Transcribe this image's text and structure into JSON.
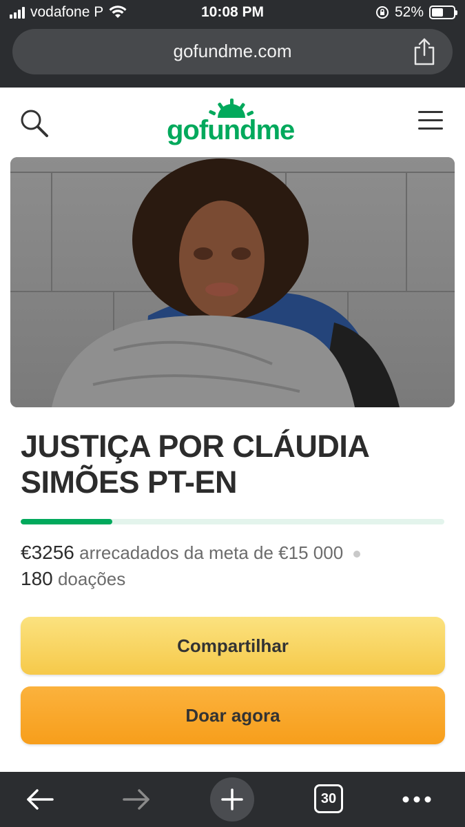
{
  "status_bar": {
    "carrier": "vodafone P",
    "time": "10:08 PM",
    "battery": "52%",
    "battery_level": 0.52
  },
  "browser": {
    "url": "gofundme.com"
  },
  "site": {
    "logo_text": "gofundme",
    "brand_color": "#02a95c"
  },
  "campaign": {
    "title": "JUSTIÇA POR CLÁUDIA SIMÕES PT-EN",
    "raised": "€3256",
    "raised_text": "arrecadados da meta de €15 000",
    "progress": 0.217,
    "donations_count": "180",
    "donations_label": "doações"
  },
  "actions": {
    "share_label": "Compartilhar",
    "donate_label": "Doar agora",
    "share_color": "#f6c94a",
    "donate_color": "#f79e1b"
  },
  "toolbar": {
    "tabs_count": "30"
  },
  "icons": [
    "signal-icon",
    "wifi-icon",
    "rotation-lock-icon",
    "battery-icon",
    "share-icon",
    "search-icon",
    "menu-icon",
    "back-arrow-icon",
    "forward-arrow-icon",
    "plus-icon",
    "more-icon"
  ]
}
